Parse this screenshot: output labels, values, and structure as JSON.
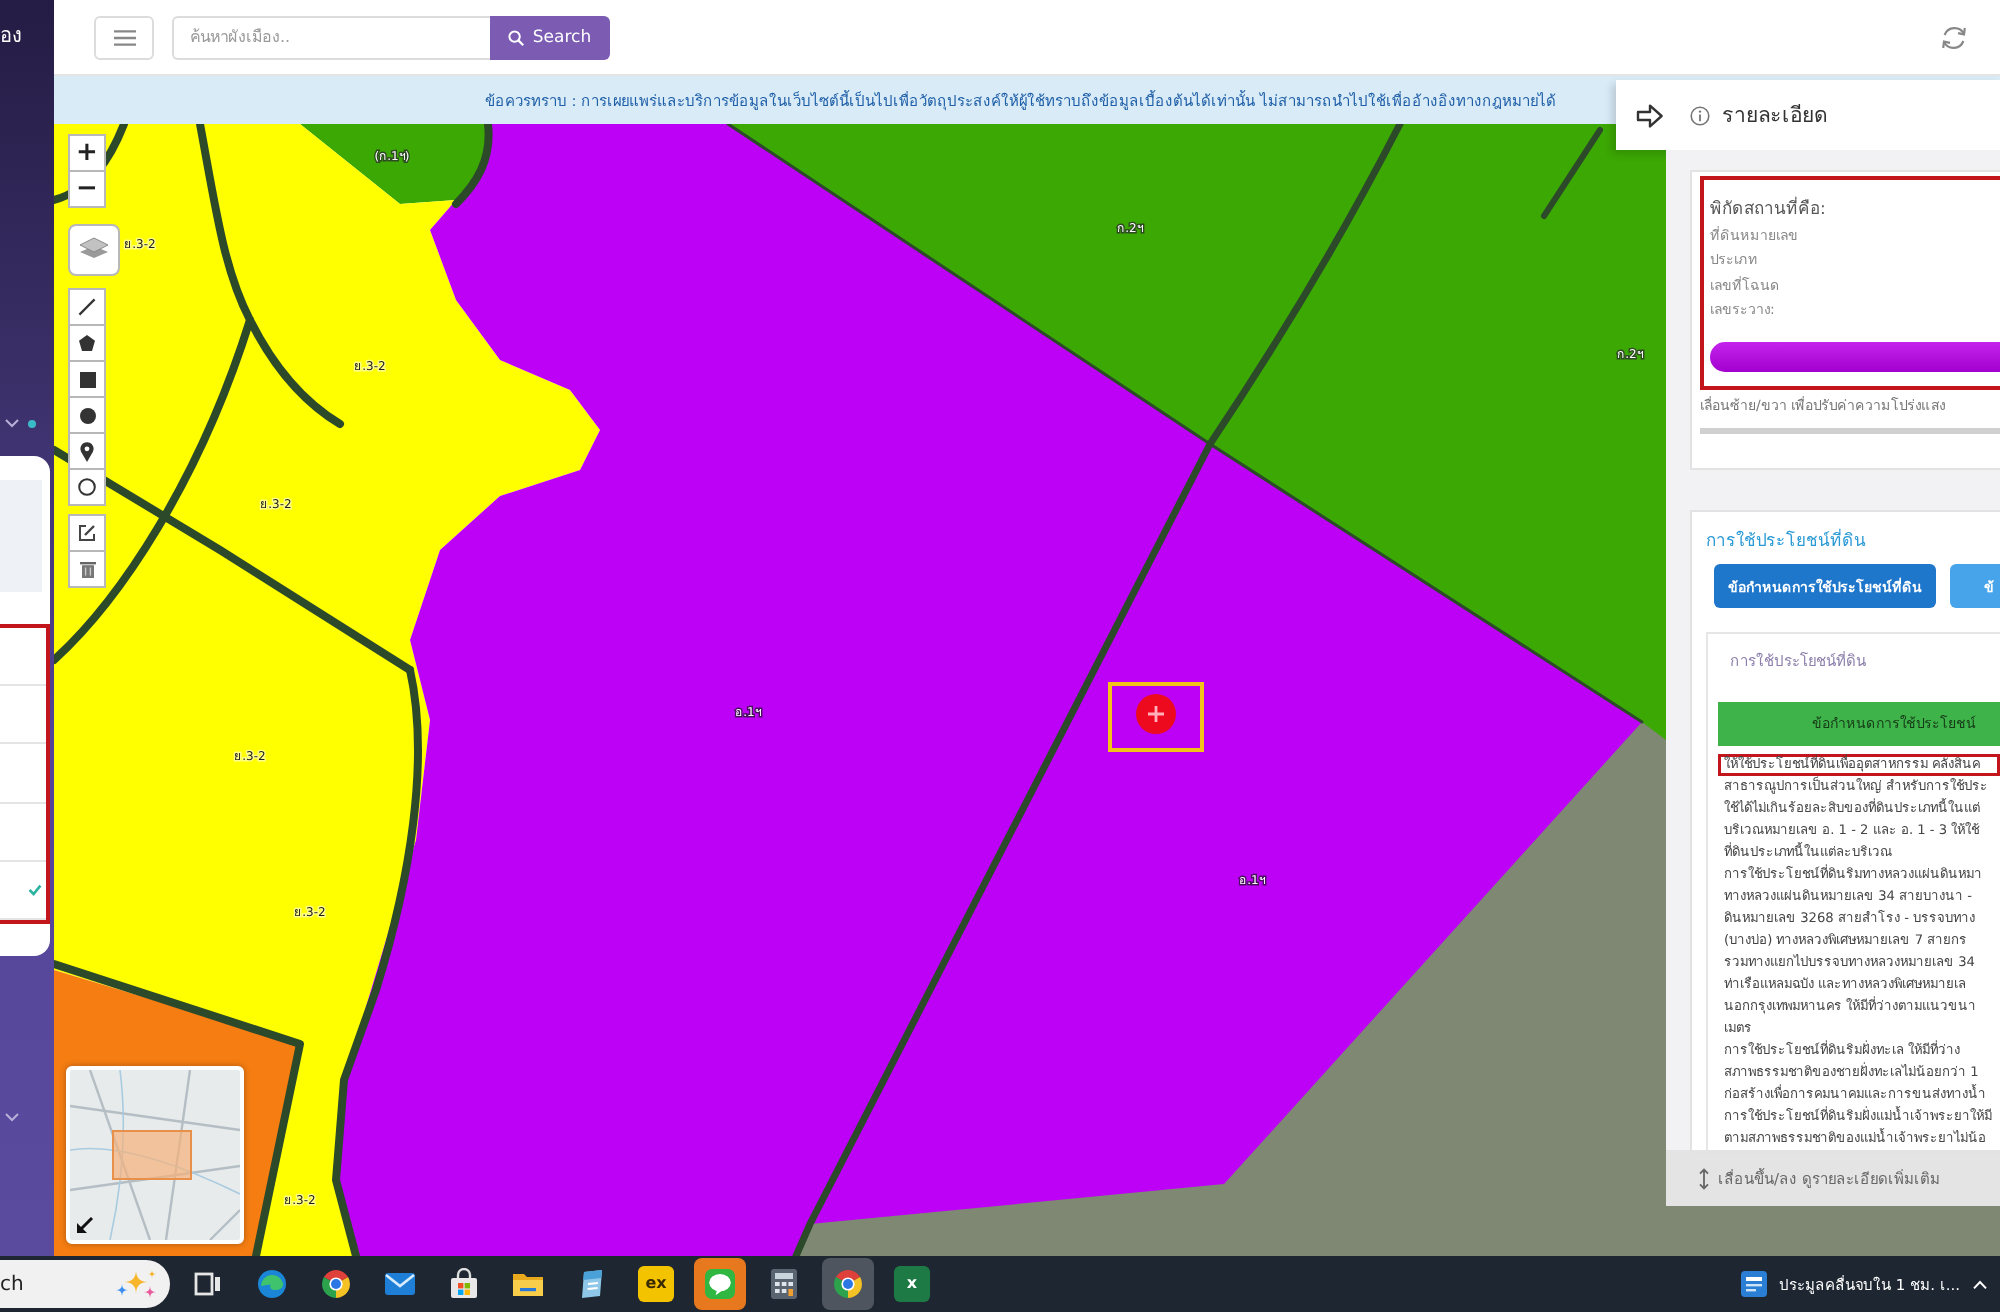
{
  "sidebar": {
    "title": "อง",
    "panel": {
      "highlighted": true,
      "rows": [
        {
          "checked": false
        },
        {
          "checked": false
        },
        {
          "checked": false
        },
        {
          "checked": false
        },
        {
          "checked": true
        }
      ]
    }
  },
  "header": {
    "search": {
      "placeholder": "ค้นหาผังเมือง..",
      "button": "Search"
    }
  },
  "notice": "ข้อควรทราบ : การเผยแพร่และบริการข้อมูลในเว็บไซต์นี้เป็นไปเพื่อวัตถุประสงค์ให้ผู้ใช้ทราบถึงข้อมูลเบื้องต้นได้เท่านั้น ไม่สามารถนำไปใช้เพื่ออ้างอิงทางกฎหมายได้",
  "map": {
    "zoom_controls": [
      "+",
      "−"
    ],
    "zone_labels": [
      {
        "kind": "agricultural",
        "text": "(ก.1ฯ)"
      },
      {
        "kind": "agricultural",
        "text": "ก.2ฯ"
      },
      {
        "kind": "residential",
        "text": "ย.3-2"
      },
      {
        "kind": "agricultural",
        "text": "ก.2ฯ"
      },
      {
        "kind": "residential",
        "text": "ย.3-2"
      },
      {
        "kind": "residential",
        "text": "ย.3-2"
      },
      {
        "kind": "industrial",
        "text": "อ.1ฯ"
      },
      {
        "kind": "residential",
        "text": "ย.3-2"
      },
      {
        "kind": "industrial",
        "text": "อ.1ฯ"
      },
      {
        "kind": "residential",
        "text": "ย.3-2"
      },
      {
        "kind": "residential",
        "text": "ย.3-2"
      }
    ],
    "marker": {
      "highlighted": true
    }
  },
  "detail_panel": {
    "title": "รายละเอียด",
    "location_card": {
      "highlighted": true,
      "heading": "พิกัดสถานที่คือ:",
      "fields": [
        "ที่ดินหมายเลข",
        "ประเภท",
        "เลขที่โฉนด",
        "เลขระวาง:"
      ],
      "opacity_hint": "เลื่อนซ้าย/ขวา เพื่อปรับค่าความโปร่งแสง",
      "opacity_slider": {
        "level": 1
      }
    },
    "land_use": {
      "title": "การใช้ประโยชน์ที่ดิน",
      "tabs": [
        {
          "label": "ข้อกำหนดการใช้ประโยชน์ที่ดิน",
          "selected": true
        },
        {
          "label": "ข้",
          "selected": false
        }
      ],
      "card_title": "การใช้ประโยชน์ที่ดิน",
      "table_header": "ข้อกำหนดการใช้ประโยชน์",
      "lines": [
        {
          "text": "ให้ใช้ประโยชน์ที่ดินเพื่ออุตสาหกรรม คลังสินค",
          "highlighted": true
        },
        {
          "text": "สาธารณูปการเป็นส่วนใหญ่ สำหรับการใช้ประ",
          "highlighted": false
        },
        {
          "text": "ใช้ได้ไม่เกินร้อยละสิบของที่ดินประเภทนี้ในแต่",
          "highlighted": false
        },
        {
          "text": "บริเวณหมายเลข อ. 1 - 2 และ อ. 1 - 3 ให้ใช้",
          "highlighted": false
        },
        {
          "text": "ที่ดินประเภทนี้ในแต่ละบริเวณ",
          "highlighted": false
        },
        {
          "text": "การใช้ประโยชน์ที่ดินริมทางหลวงแผ่นดินหมา",
          "highlighted": false
        },
        {
          "text": "ทางหลวงแผ่นดินหมายเลข 34 สายบางนา -",
          "highlighted": false
        },
        {
          "text": "ดินหมายเลข 3268 สายสำโรง - บรรจบทาง",
          "highlighted": false
        },
        {
          "text": "(บางบ่อ) ทางหลวงพิเศษหมายเลข 7 สายกร",
          "highlighted": false
        },
        {
          "text": "รวมทางแยกไปบรรจบทางหลวงหมายเลข 34",
          "highlighted": false
        },
        {
          "text": "ท่าเรือแหลมฉบัง และทางหลวงพิเศษหมายเล",
          "highlighted": false
        },
        {
          "text": "นอกกรุงเทพมหานคร ให้มีที่ว่างตามแนวขนา",
          "highlighted": false
        },
        {
          "text": "เมตร",
          "highlighted": false
        },
        {
          "text": "การใช้ประโยชน์ที่ดินริมฝั่งทะเล ให้มีที่ว่าง",
          "highlighted": false
        },
        {
          "text": "สภาพธรรมชาติของชายฝั่งทะเลไม่น้อยกว่า 1",
          "highlighted": false
        },
        {
          "text": "ก่อสร้างเพื่อการคมนาคมและการขนส่งทางน้ำ",
          "highlighted": false
        },
        {
          "text": "การใช้ประโยชน์ที่ดินริมฝั่งแม่น้ำเจ้าพระยาให้มี",
          "highlighted": false
        },
        {
          "text": "ตามสภาพธรรมชาติของแม่น้ำเจ้าพระยาไม่น้อ",
          "highlighted": false
        }
      ]
    },
    "scroll_hint": "เลื่อนขึ้น/ลง ดูรายละเอียดเพิ่มเติม"
  },
  "taskbar": {
    "search_text": "ch",
    "apps": [
      {
        "kind": "taskview",
        "active": false,
        "flashing": false
      },
      {
        "kind": "edge",
        "active": false,
        "flashing": false
      },
      {
        "kind": "chrome",
        "active": false,
        "flashing": false
      },
      {
        "kind": "mail",
        "active": false,
        "flashing": false
      },
      {
        "kind": "store",
        "active": false,
        "flashing": false
      },
      {
        "kind": "folder",
        "active": false,
        "flashing": false
      },
      {
        "kind": "notes",
        "active": false,
        "flashing": false
      },
      {
        "kind": "ex",
        "label": "ex",
        "active": false,
        "flashing": false
      },
      {
        "kind": "line",
        "active": false,
        "flashing": true
      },
      {
        "kind": "calculator",
        "active": false,
        "flashing": false
      },
      {
        "kind": "chrome",
        "active": true,
        "flashing": false
      },
      {
        "kind": "excel",
        "label": "x",
        "active": false,
        "flashing": false
      }
    ],
    "news": "ประมูลคลื่นจบใน 1 ชม. เ..."
  }
}
